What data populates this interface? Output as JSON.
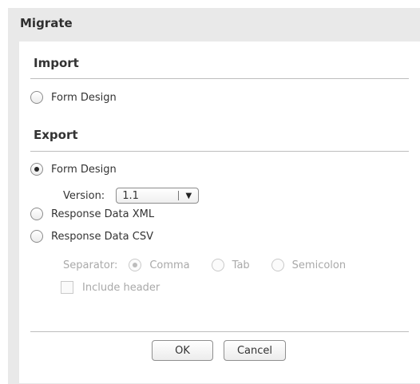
{
  "dialog": {
    "title": "Migrate"
  },
  "import": {
    "heading": "Import",
    "options": [
      {
        "label": "Form Design",
        "checked": false
      }
    ]
  },
  "export": {
    "heading": "Export",
    "form_design": {
      "label": "Form Design",
      "checked": true
    },
    "version": {
      "label": "Version:",
      "selected": "1.1"
    },
    "response_xml": {
      "label": "Response Data XML",
      "checked": false
    },
    "response_csv": {
      "label": "Response Data CSV",
      "checked": false
    },
    "separator": {
      "label": "Separator:",
      "options": [
        {
          "label": "Comma",
          "checked": true
        },
        {
          "label": "Tab",
          "checked": false
        },
        {
          "label": "Semicolon",
          "checked": false
        }
      ]
    },
    "include_header": {
      "label": "Include header",
      "checked": false
    }
  },
  "buttons": {
    "ok": "OK",
    "cancel": "Cancel"
  }
}
